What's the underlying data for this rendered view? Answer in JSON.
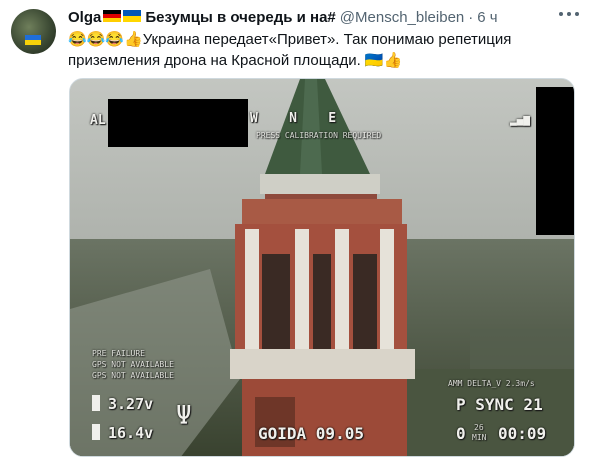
{
  "tweet": {
    "author_name": "Olga",
    "author_name_suffix": "Безумцы в очередь и на#",
    "handle": "@Mensch_bleiben",
    "separator": "·",
    "time": "6 ч",
    "text_line1": "😂😂😂👍Украина передает«Привет». Так понимаю репетиция",
    "text_line2": "приземления дрона на Красной площади. 🇺🇦👍"
  },
  "osd": {
    "top_left": "AL",
    "compass": "W    N    E",
    "calibration": "PRESS CALIBRATION REQUIRED",
    "left_status_1": "PRE FAILURE",
    "left_status_2": "GPS NOT AVAILABLE",
    "left_status_3": "GPS NOT AVAILABLE",
    "battery_1": "3.27v",
    "battery_2": "16.4v",
    "callsign": "GOIDA 09.05",
    "delta": "AMM DELTA_V 2.3m/s",
    "sync": "P SYNC 21",
    "zero": "0",
    "timer_label_top": "26",
    "timer_label_bottom": "MIN",
    "timer": "00:09"
  },
  "colors": {
    "ukraine_blue": "#0057b7",
    "ukraine_yellow": "#ffd700",
    "muted_text": "#536471"
  }
}
